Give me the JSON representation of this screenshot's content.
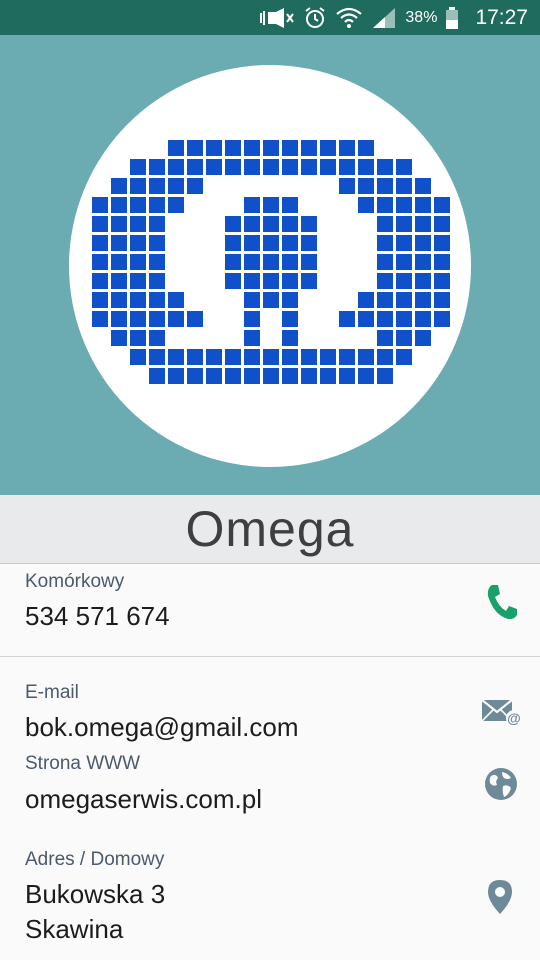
{
  "status_bar": {
    "battery_percent": "38%",
    "time": "17:27",
    "icons": [
      "vibrate-silent-icon",
      "alarm-icon",
      "wifi-icon",
      "signal-icon",
      "battery-icon"
    ]
  },
  "contact": {
    "name": "Omega",
    "avatar": "omega-pixel-logo",
    "logo_color": "#1050c9"
  },
  "phone": {
    "label": "Komórkowy",
    "value": "534 571 674",
    "action_icon": "phone-icon",
    "action_color": "#1aa06a"
  },
  "email": {
    "label": "E-mail",
    "value": "bok.omega@gmail.com",
    "action_icon": "email-icon"
  },
  "website": {
    "label": "Strona WWW",
    "value": "omegaserwis.com.pl",
    "action_icon": "globe-icon"
  },
  "address": {
    "label": "Adres / Domowy",
    "line1": "Bukowska 3",
    "line2": "Skawina",
    "action_icon": "map-pin-icon"
  },
  "colors": {
    "status_bar": "#1f6b5e",
    "header_bg": "#6aacb2",
    "icon_grey": "#6e8a99"
  }
}
